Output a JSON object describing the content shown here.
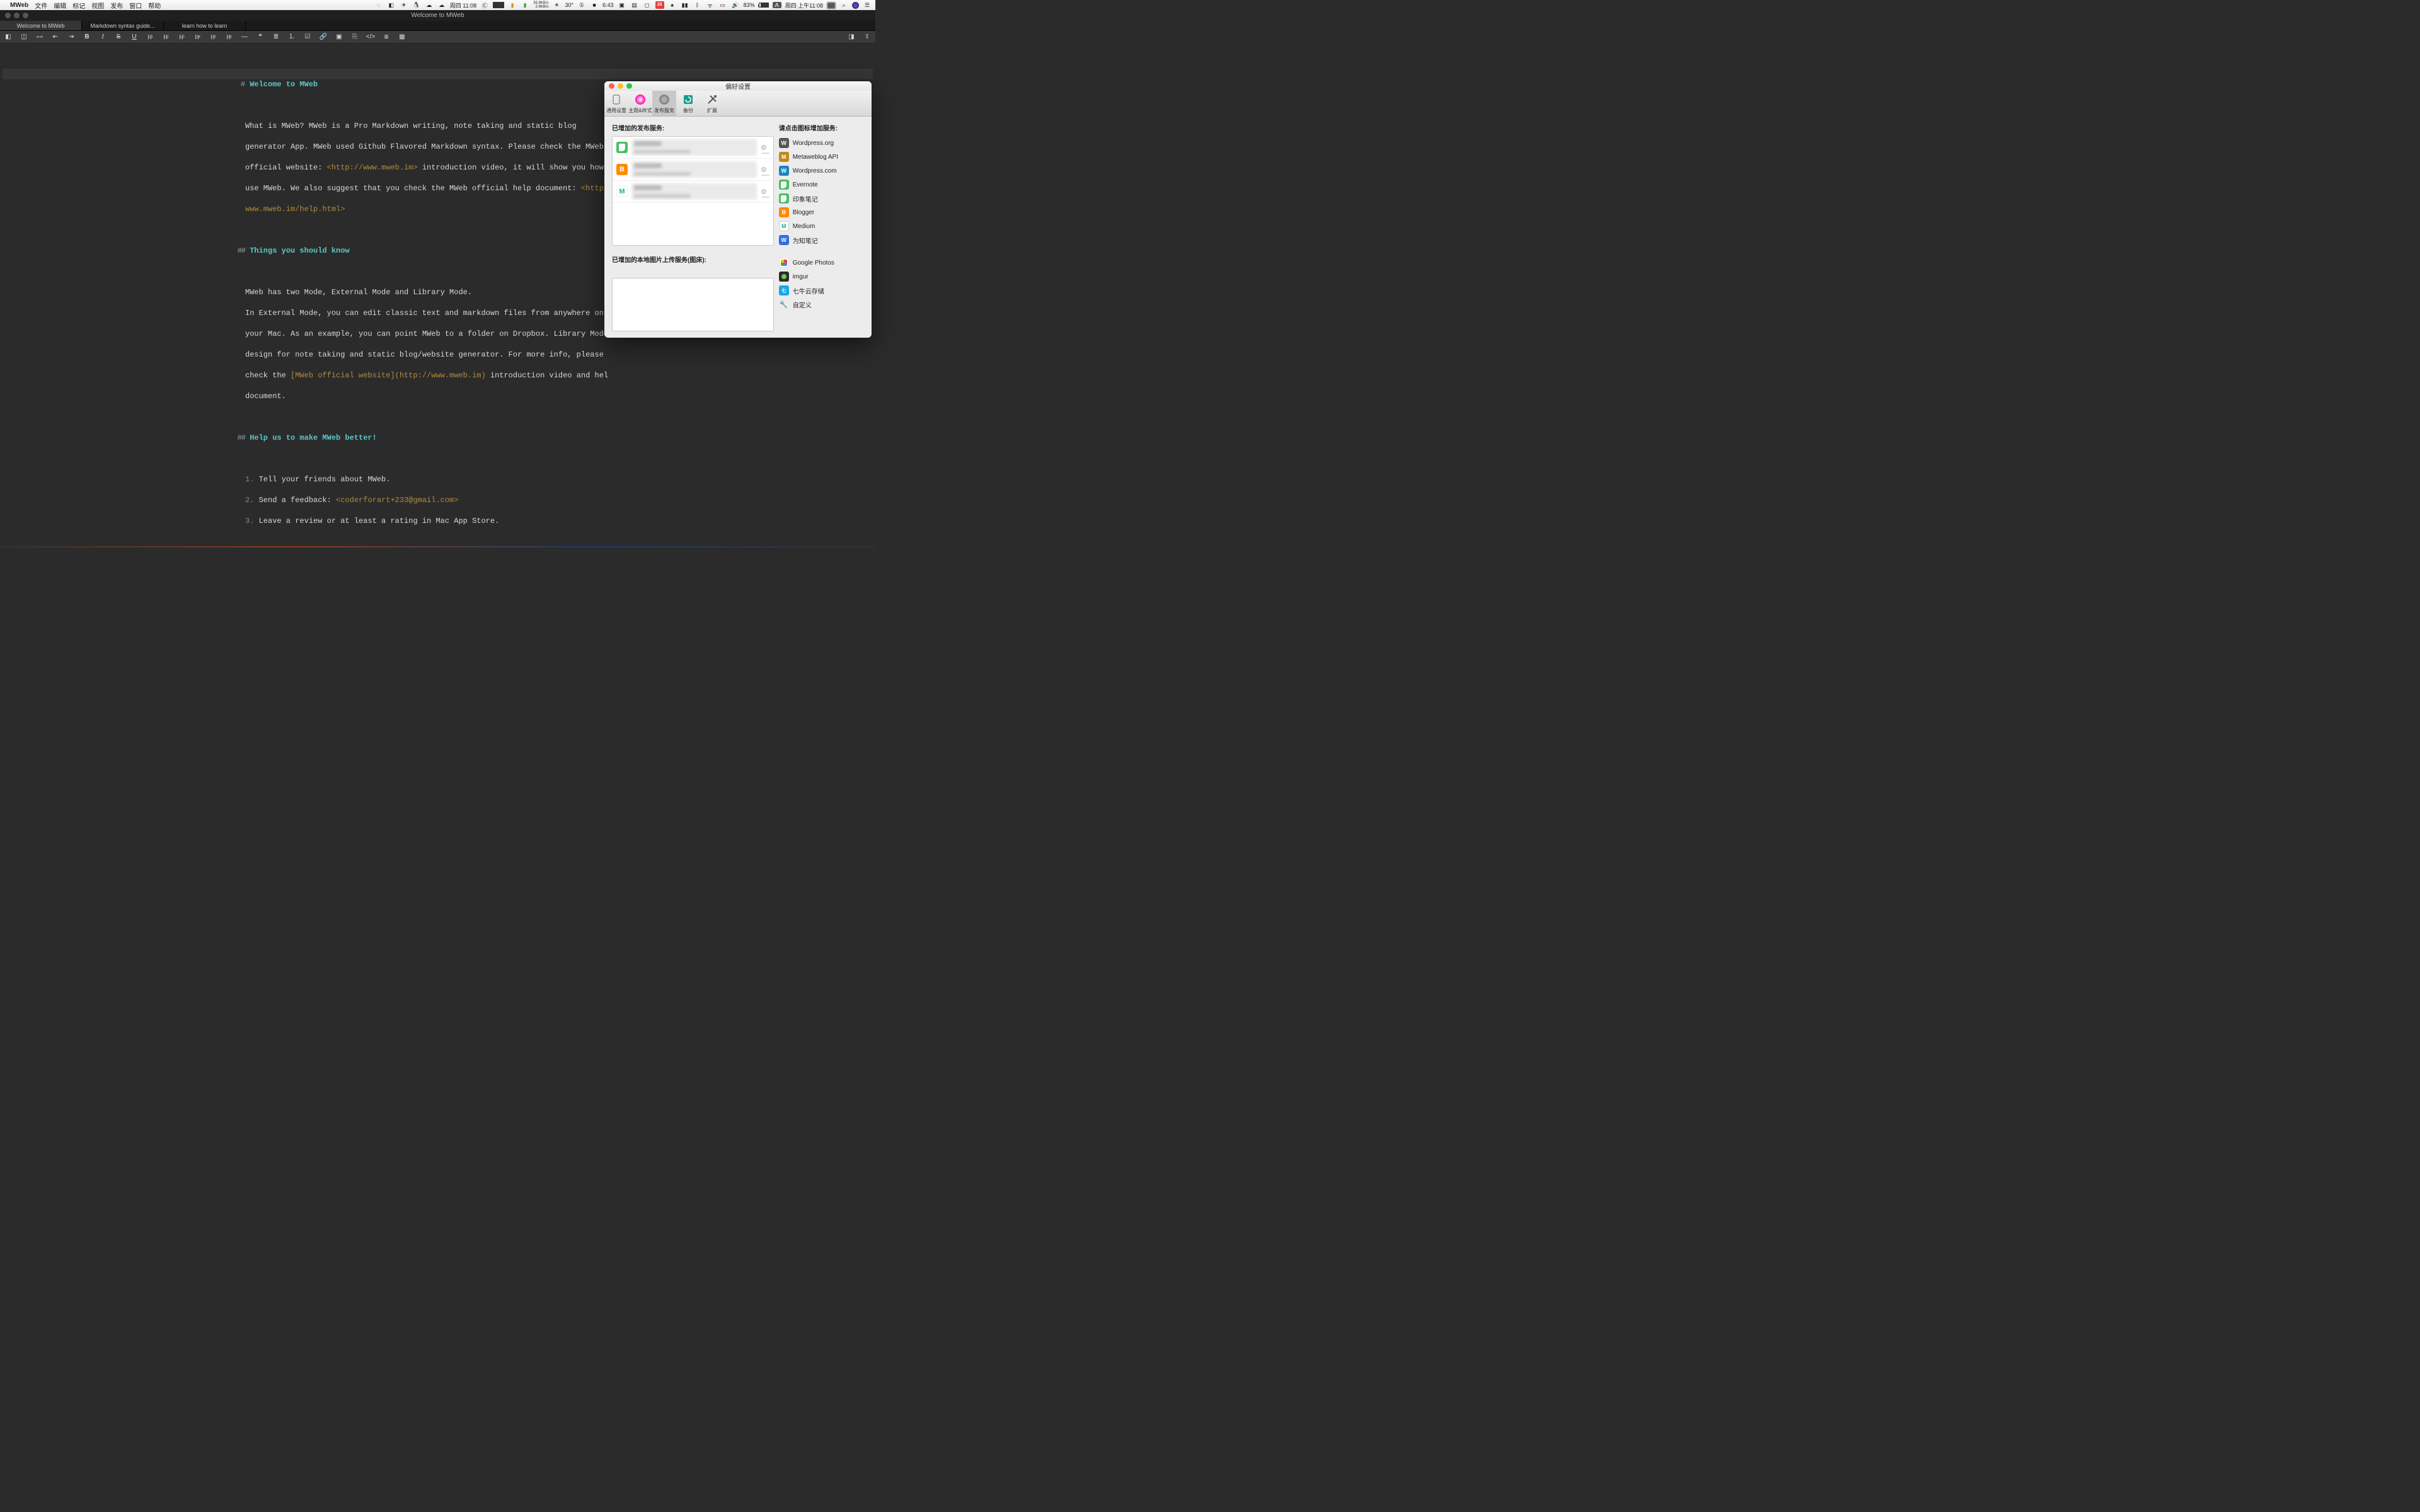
{
  "menubar": {
    "app": "MWeb",
    "items": [
      "文件",
      "编辑",
      "标记",
      "视图",
      "发布",
      "窗口",
      "帮助"
    ],
    "right": {
      "day_time_cn": "周四 11:08",
      "net_up": "39.9KB/s",
      "net_down": "2.6KB/s",
      "temp": "30°",
      "timer": "6:43",
      "cal": "20",
      "battery_pct": "83%",
      "clock": "周四 上午11:08"
    }
  },
  "window": {
    "title": "Welcome to MWeb"
  },
  "tabs": [
    {
      "label": "Welcome to MWeb",
      "active": true
    },
    {
      "label": "Markdown syntax guide...",
      "active": false
    },
    {
      "label": "learn how to learn",
      "active": false
    }
  ],
  "toolbar_icons": [
    "left-panel",
    "split-panel",
    "link",
    "outdent",
    "indent",
    "bold",
    "italic",
    "strike",
    "underline",
    "H1",
    "H2",
    "H3",
    "H4",
    "H5",
    "H6",
    "hr",
    "quote",
    "ul",
    "ol",
    "image",
    "link2",
    "image2",
    "table",
    "code",
    "codeblock",
    "table2"
  ],
  "document": {
    "h1": "Welcome to MWeb",
    "p1a": "What is MWeb? MWeb is a Pro Markdown writing, note taking and static blog",
    "p1b": "generator App. MWeb used Github Flavored Markdown syntax. Please check the MWeb",
    "p1c_pre": "official website: ",
    "p1c_link": "<http://www.mweb.im>",
    "p1c_post": " introduction video, it will show you how",
    "p1d_pre": "use MWeb. We also suggest that you check the MWeb official help document: ",
    "p1d_link": "<http:",
    "p1e_link": "www.mweb.im/help.html>",
    "h2a": "Things you should know",
    "p2a": "MWeb has two Mode, External Mode and Library Mode.",
    "p2b": "In External Mode, you can edit classic text and markdown files from anywhere on",
    "p2c": "your Mac. As an example, you can point MWeb to a folder on Dropbox. Library Mode",
    "p2d": "design for note taking and static blog/website generator. For more info, please",
    "p2e_pre": "check the ",
    "p2e_link": "[MWeb official website](http://www.mweb.im)",
    "p2e_post": " introduction video and hel",
    "p2f": "document.",
    "h2b": "Help us to make MWeb better!",
    "li1_n": "1.",
    "li1": "Tell your friends about MWeb.",
    "li2_n": "2.",
    "li2_pre": "Send a feedback: ",
    "li2_link": "<coderforart+233@gmail.com>",
    "li3_n": "3.",
    "li3": "Leave a review or at least a rating in Mac App Store."
  },
  "prefs": {
    "title": "偏好设置",
    "tabs": [
      {
        "label": "通用设置",
        "icon": "general"
      },
      {
        "label": "主题&样式",
        "icon": "theme"
      },
      {
        "label": "发布服务",
        "icon": "publish",
        "selected": true
      },
      {
        "label": "备份",
        "icon": "backup"
      },
      {
        "label": "扩展",
        "icon": "extension"
      }
    ],
    "left_label": "已增加的发布服务:",
    "left_label2": "已增加的本地图片上传服务(图床):",
    "right_label": "请点击图标增加服务:",
    "existing_services": [
      {
        "type": "evernote"
      },
      {
        "type": "blogger"
      },
      {
        "type": "medium"
      }
    ],
    "add_services": [
      {
        "label": "Wordpress.org",
        "icon": "wp"
      },
      {
        "label": "Metaweblog API",
        "icon": "meta"
      },
      {
        "label": "Wordpress.com",
        "icon": "wpcom"
      },
      {
        "label": "Evernote",
        "icon": "ev"
      },
      {
        "label": "印象笔记",
        "icon": "evcn"
      },
      {
        "label": "Blogger",
        "icon": "blog"
      },
      {
        "label": "Medium",
        "icon": "medium"
      },
      {
        "label": "为知笔记",
        "icon": "wiz"
      }
    ],
    "add_image_services": [
      {
        "label": "Google Photos",
        "icon": "gp"
      },
      {
        "label": "imgur",
        "icon": "imgur"
      },
      {
        "label": "七牛云存储",
        "icon": "qn"
      },
      {
        "label": "自定义",
        "icon": "custom"
      }
    ]
  }
}
